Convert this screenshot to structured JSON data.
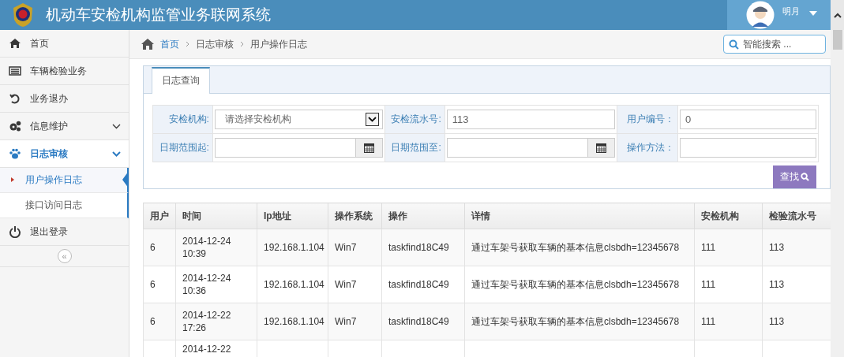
{
  "header": {
    "title": "机动车安检机构监管业务联网系统",
    "user": "明月"
  },
  "sidebar": {
    "items": [
      {
        "label": "首页",
        "selected": false
      },
      {
        "label": "车辆检验业务",
        "selected": false
      },
      {
        "label": "业务退办",
        "selected": false
      },
      {
        "label": "信息维护",
        "expanded": false,
        "selected": false
      },
      {
        "label": "日志审核",
        "expanded": true,
        "selected": true,
        "children": [
          {
            "label": "用户操作日志",
            "selected": true
          },
          {
            "label": "接口访问日志",
            "selected": false
          }
        ]
      },
      {
        "label": "退出登录",
        "selected": false
      }
    ],
    "collapse": "«"
  },
  "breadcrumb": [
    "首页",
    "日志审核",
    "用户操作日志"
  ],
  "search": {
    "placeholder": "智能搜索 ..."
  },
  "tabs": [
    {
      "label": "日志查询",
      "selected": true
    }
  ],
  "form": {
    "rows": [
      [
        {
          "label": "安检机构:",
          "kind": "select",
          "placeholder": "请选择安检机构"
        },
        {
          "label": "安检流水号:",
          "kind": "text",
          "value": "113"
        },
        {
          "label": "用户编号：",
          "kind": "text",
          "value": "0"
        }
      ],
      [
        {
          "label": "日期范围起:",
          "kind": "date"
        },
        {
          "label": "日期范围至:",
          "kind": "date"
        },
        {
          "label": "操作方法：",
          "kind": "text"
        }
      ]
    ],
    "button": "查找"
  },
  "table": {
    "columns": [
      "用户",
      "时间",
      "Ip地址",
      "操作系统",
      "操作",
      "详情",
      "安检机构",
      "检验流水号"
    ],
    "rows": [
      [
        "6",
        "2014-12-24 10:39",
        "192.168.1.104",
        "Win7",
        "taskfind18C49",
        "通过车架号获取车辆的基本信息clsbdh=12345678",
        "111",
        "113"
      ],
      [
        "6",
        "2014-12-24 10:36",
        "192.168.1.104",
        "Win7",
        "taskfind18C49",
        "通过车架号获取车辆的基本信息clsbdh=12345678",
        "111",
        "113"
      ],
      [
        "6",
        "2014-12-22 17:26",
        "192.168.1.104",
        "Win7",
        "taskfind18C49",
        "通过车架号获取车辆的基本信息clsbdh=12345678",
        "111",
        "113"
      ],
      [
        null,
        "2014-12-22",
        null,
        null,
        null,
        null,
        null,
        null
      ]
    ]
  }
}
